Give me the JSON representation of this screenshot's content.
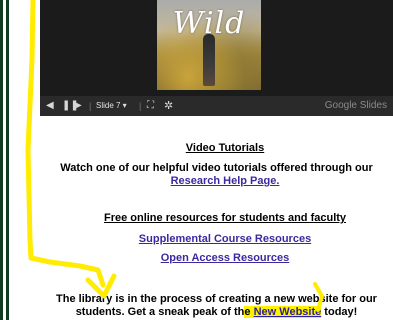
{
  "slides": {
    "poster_title": "Wild",
    "slide_indicator": "Slide 7 ▾",
    "brand": "Google Slides",
    "icons": {
      "prev": "arrow-left-icon",
      "pause": "pause-icon",
      "next": "arrow-right-icon",
      "fullscreen": "fullscreen-icon",
      "settings": "gear-icon"
    }
  },
  "video_tutorials": {
    "heading": "Video Tutorials",
    "body": "Watch one of our helpful video tutorials offered through our",
    "link": "Research Help Page."
  },
  "free_resources": {
    "heading": "Free online resources for students and faculty",
    "links": [
      "Supplemental Course Resources",
      "Open Access Resources"
    ]
  },
  "notice": {
    "line1": "The library is in the process of creating a new website for our",
    "line2_before": "students. Get a sneak peak of th",
    "line2_hl": "e ",
    "link": "New Website",
    "line2_after": " today!"
  },
  "colors": {
    "annotation": "#ffec00",
    "link": "#3b2a9e",
    "frame": "#0f3b1f",
    "highlight": "#fff200"
  }
}
